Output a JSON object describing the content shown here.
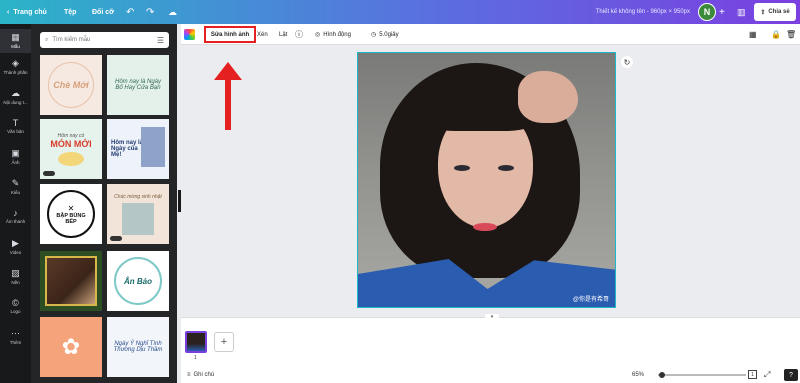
{
  "topbar": {
    "home": "Trang chủ",
    "file": "Tệp",
    "resize": "Đổi cỡ",
    "title": "Thiết kế không tên - 960px × 950px",
    "avatar_initial": "N",
    "share": "Chia sẻ"
  },
  "rail": {
    "items": [
      {
        "label": "Mẫu",
        "icon": "template-icon"
      },
      {
        "label": "Thành phần",
        "icon": "elements-icon"
      },
      {
        "label": "Nội dung t...",
        "icon": "upload-icon"
      },
      {
        "label": "Văn bản",
        "icon": "text-icon"
      },
      {
        "label": "Ảnh",
        "icon": "photo-icon"
      },
      {
        "label": "Kiểu",
        "icon": "styles-icon"
      },
      {
        "label": "Âm thanh",
        "icon": "audio-icon"
      },
      {
        "label": "Video",
        "icon": "video-icon"
      },
      {
        "label": "Nền",
        "icon": "background-icon"
      },
      {
        "label": "Logo",
        "icon": "logo-icon"
      },
      {
        "label": "Thêm",
        "icon": "more-icon"
      }
    ]
  },
  "panel": {
    "search_placeholder": "Tìm kiếm mẫu",
    "templates": [
      {
        "line1": "Chè Mới",
        "line2": ""
      },
      {
        "line1": "Hôm nay là Ngày Bố Hay Cửa Bạn",
        "line2": ""
      },
      {
        "line1": "MÓN MỚI",
        "line2": "Hôm nay có"
      },
      {
        "line1": "Hôm nay là Ngày của Mẹ!",
        "line2": ""
      },
      {
        "line1": "BẬP BÙNG BẾP",
        "line2": ""
      },
      {
        "line1": "Chúc mừng sinh nhật",
        "line2": ""
      },
      {
        "line1": "",
        "line2": ""
      },
      {
        "line1": "Ân Bảo",
        "line2": ""
      },
      {
        "line1": "",
        "line2": ""
      },
      {
        "line1": "Ngày Ý Nghĩ Tình Thương Dịu Thầm",
        "line2": ""
      }
    ]
  },
  "toolbar": {
    "edit_image": "Sửa hình ảnh",
    "crop": "Xén",
    "flip": "Lật",
    "animate": "Hình động",
    "duration": "5.0giây"
  },
  "canvas": {
    "watermark": "@你是有希哥"
  },
  "pages": {
    "page_number": "1"
  },
  "footer": {
    "notes": "Ghi chú",
    "zoom": "65%",
    "page_count": "1"
  },
  "colors": {
    "highlight": "#e42020",
    "selection": "#1fb8c9",
    "brand": "#7b3fe0"
  }
}
